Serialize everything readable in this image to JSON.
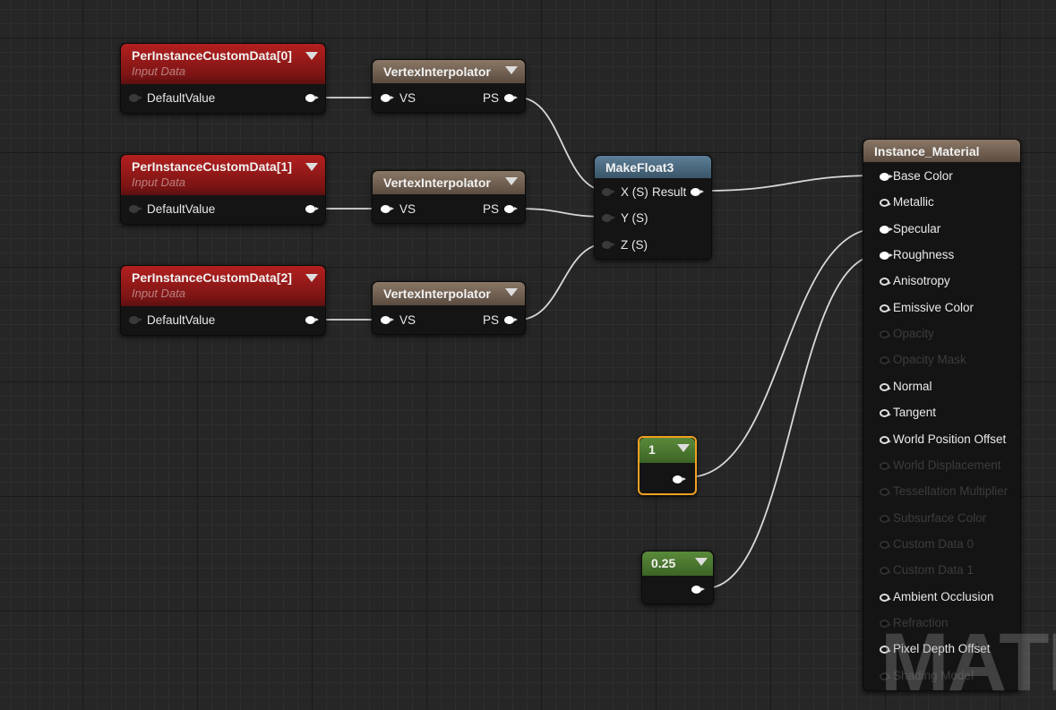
{
  "custom_data_nodes": [
    {
      "title": "PerInstanceCustomData[0]",
      "subtitle": "Input Data",
      "pin": "DefaultValue"
    },
    {
      "title": "PerInstanceCustomData[1]",
      "subtitle": "Input Data",
      "pin": "DefaultValue"
    },
    {
      "title": "PerInstanceCustomData[2]",
      "subtitle": "Input Data",
      "pin": "DefaultValue"
    }
  ],
  "interpolator_nodes": [
    {
      "title": "VertexInterpolator",
      "input": "VS",
      "output": "PS"
    },
    {
      "title": "VertexInterpolator",
      "input": "VS",
      "output": "PS"
    },
    {
      "title": "VertexInterpolator",
      "input": "VS",
      "output": "PS"
    }
  ],
  "make_float3": {
    "title": "MakeFloat3",
    "inputs": [
      "X (S)",
      "Y (S)",
      "Z (S)"
    ],
    "output": "Result"
  },
  "constants": [
    {
      "value": "1",
      "selected": true
    },
    {
      "value": "0.25",
      "selected": false
    }
  ],
  "material": {
    "title": "Instance_Material",
    "inputs": [
      {
        "label": "Base Color",
        "state": "connected"
      },
      {
        "label": "Metallic",
        "state": "enabled"
      },
      {
        "label": "Specular",
        "state": "connected"
      },
      {
        "label": "Roughness",
        "state": "connected"
      },
      {
        "label": "Anisotropy",
        "state": "enabled"
      },
      {
        "label": "Emissive Color",
        "state": "enabled"
      },
      {
        "label": "Opacity",
        "state": "disabled"
      },
      {
        "label": "Opacity Mask",
        "state": "disabled"
      },
      {
        "label": "Normal",
        "state": "enabled"
      },
      {
        "label": "Tangent",
        "state": "enabled"
      },
      {
        "label": "World Position Offset",
        "state": "enabled"
      },
      {
        "label": "World Displacement",
        "state": "disabled"
      },
      {
        "label": "Tessellation Multiplier",
        "state": "disabled"
      },
      {
        "label": "Subsurface Color",
        "state": "disabled"
      },
      {
        "label": "Custom Data 0",
        "state": "disabled"
      },
      {
        "label": "Custom Data 1",
        "state": "disabled"
      },
      {
        "label": "Ambient Occlusion",
        "state": "enabled"
      },
      {
        "label": "Refraction",
        "state": "disabled"
      },
      {
        "label": "Pixel Depth Offset",
        "state": "enabled"
      },
      {
        "label": "Shading Model",
        "state": "disabled"
      }
    ]
  },
  "watermark": "MATERIAL",
  "colors": {
    "selection": "#f0a020",
    "wire": "#d8d8d8"
  }
}
